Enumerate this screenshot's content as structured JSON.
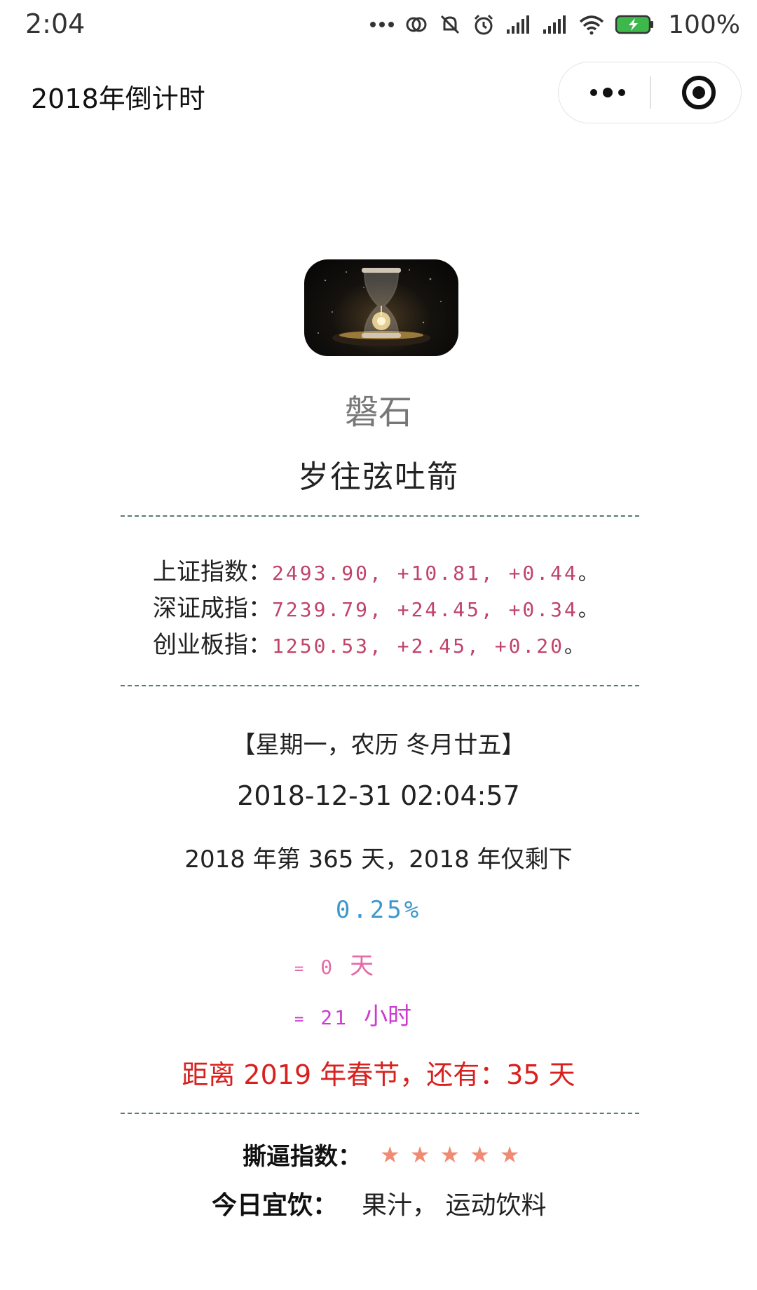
{
  "status_bar": {
    "time": "2:04",
    "battery_percent": "100%"
  },
  "nav": {
    "title": "2018年倒计时"
  },
  "profile": {
    "author": "磐石",
    "motto": "岁往弦吐箭"
  },
  "indices": [
    {
      "name": "上证指数：",
      "values": "2493.90, +10.81, +0.44",
      "end": "。"
    },
    {
      "name": "深证成指：",
      "values": "7239.79, +24.45, +0.34",
      "end": "。"
    },
    {
      "name": "创业板指：",
      "values": "1250.53, +2.45, +0.20",
      "end": "。"
    }
  ],
  "calendar": {
    "weekday_lunar": "【星期一，农历 冬月廿五】",
    "datetime": "2018-12-31 02:04:57",
    "day_of_year": "2018 年第 365 天，2018 年仅剩下",
    "percent_left": "0.25%",
    "remaining_days": {
      "eq": "=",
      "value": "0",
      "unit": "天"
    },
    "remaining_hours": {
      "eq": "=",
      "value": "21",
      "unit": "小时"
    },
    "festival": "距离 2019 年春节，还有：35 天"
  },
  "fun": {
    "rating_label": "撕逼指数：",
    "rating_stars": 5,
    "star_char": "★",
    "drink_label": "今日宜饮：",
    "drink_value": "果汁， 运动饮料"
  },
  "colors": {
    "index_values": "#c0436a",
    "percent": "#3d97cc",
    "days": "#e56aa8",
    "hours": "#cc3bd1",
    "festival": "#d8211f",
    "stars": "#f08a73",
    "divider": "#5a7a72"
  }
}
